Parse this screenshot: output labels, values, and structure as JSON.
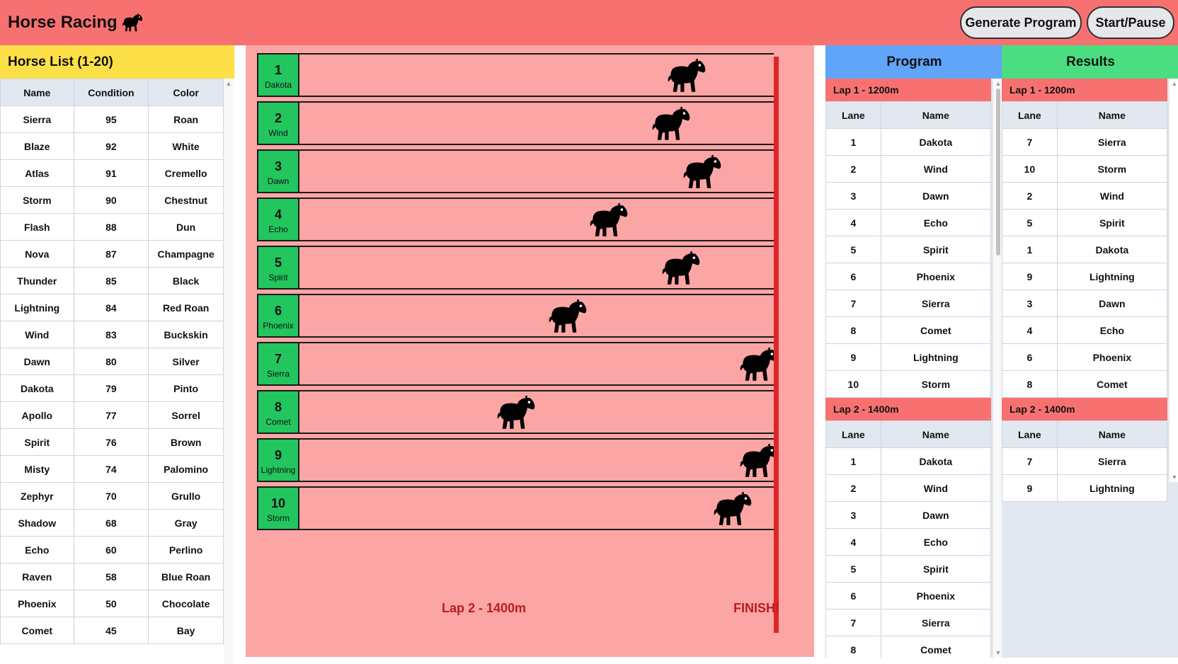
{
  "header": {
    "title": "Horse Racing",
    "generate_label": "Generate Program",
    "start_label": "Start/Pause"
  },
  "horse_list": {
    "title": "Horse List (1-20)",
    "columns": [
      "Name",
      "Condition",
      "Color"
    ],
    "rows": [
      [
        "Sierra",
        "95",
        "Roan"
      ],
      [
        "Blaze",
        "92",
        "White"
      ],
      [
        "Atlas",
        "91",
        "Cremello"
      ],
      [
        "Storm",
        "90",
        "Chestnut"
      ],
      [
        "Flash",
        "88",
        "Dun"
      ],
      [
        "Nova",
        "87",
        "Champagne"
      ],
      [
        "Thunder",
        "85",
        "Black"
      ],
      [
        "Lightning",
        "84",
        "Red Roan"
      ],
      [
        "Wind",
        "83",
        "Buckskin"
      ],
      [
        "Dawn",
        "80",
        "Silver"
      ],
      [
        "Dakota",
        "79",
        "Pinto"
      ],
      [
        "Apollo",
        "77",
        "Sorrel"
      ],
      [
        "Spirit",
        "76",
        "Brown"
      ],
      [
        "Misty",
        "74",
        "Palomino"
      ],
      [
        "Zephyr",
        "70",
        "Grullo"
      ],
      [
        "Shadow",
        "68",
        "Gray"
      ],
      [
        "Echo",
        "60",
        "Perlino"
      ],
      [
        "Raven",
        "58",
        "Blue Roan"
      ],
      [
        "Phoenix",
        "50",
        "Chocolate"
      ],
      [
        "Comet",
        "45",
        "Bay"
      ]
    ]
  },
  "track": {
    "lanes": [
      {
        "num": "1",
        "name": "Dakota",
        "progress": 0.82
      },
      {
        "num": "2",
        "name": "Wind",
        "progress": 0.79
      },
      {
        "num": "3",
        "name": "Dawn",
        "progress": 0.85
      },
      {
        "num": "4",
        "name": "Echo",
        "progress": 0.67
      },
      {
        "num": "5",
        "name": "Spirit",
        "progress": 0.81
      },
      {
        "num": "6",
        "name": "Phoenix",
        "progress": 0.59
      },
      {
        "num": "7",
        "name": "Sierra",
        "progress": 0.96
      },
      {
        "num": "8",
        "name": "Comet",
        "progress": 0.49
      },
      {
        "num": "9",
        "name": "Lightning",
        "progress": 0.96
      },
      {
        "num": "10",
        "name": "Storm",
        "progress": 0.91
      }
    ],
    "lap_label": "Lap 2 - 1400m",
    "finish_label": "FINISH!"
  },
  "program": {
    "title": "Program",
    "columns": [
      "Lane",
      "Name"
    ],
    "laps": [
      {
        "title": "Lap 1 - 1200m",
        "rows": [
          [
            "1",
            "Dakota"
          ],
          [
            "2",
            "Wind"
          ],
          [
            "3",
            "Dawn"
          ],
          [
            "4",
            "Echo"
          ],
          [
            "5",
            "Spirit"
          ],
          [
            "6",
            "Phoenix"
          ],
          [
            "7",
            "Sierra"
          ],
          [
            "8",
            "Comet"
          ],
          [
            "9",
            "Lightning"
          ],
          [
            "10",
            "Storm"
          ]
        ]
      },
      {
        "title": "Lap 2 - 1400m",
        "rows": [
          [
            "1",
            "Dakota"
          ],
          [
            "2",
            "Wind"
          ],
          [
            "3",
            "Dawn"
          ],
          [
            "4",
            "Echo"
          ],
          [
            "5",
            "Spirit"
          ],
          [
            "6",
            "Phoenix"
          ],
          [
            "7",
            "Sierra"
          ],
          [
            "8",
            "Comet"
          ]
        ]
      }
    ]
  },
  "results": {
    "title": "Results",
    "columns": [
      "Lane",
      "Name"
    ],
    "laps": [
      {
        "title": "Lap 1 - 1200m",
        "rows": [
          [
            "7",
            "Sierra"
          ],
          [
            "10",
            "Storm"
          ],
          [
            "2",
            "Wind"
          ],
          [
            "5",
            "Spirit"
          ],
          [
            "1",
            "Dakota"
          ],
          [
            "9",
            "Lightning"
          ],
          [
            "3",
            "Dawn"
          ],
          [
            "4",
            "Echo"
          ],
          [
            "6",
            "Phoenix"
          ],
          [
            "8",
            "Comet"
          ]
        ]
      },
      {
        "title": "Lap 2 - 1400m",
        "rows": [
          [
            "7",
            "Sierra"
          ],
          [
            "9",
            "Lightning"
          ]
        ]
      }
    ]
  },
  "icons": {
    "title_icon": "horse-icon",
    "lane_icon": "horse-icon"
  },
  "colors": {
    "header_bg": "#f87171",
    "horse_list_head": "#fde047",
    "track_bg": "#fca5a5",
    "lane_box": "#22c55e",
    "finish_line": "#dc2626",
    "program_head": "#60a5fa",
    "results_head": "#4ade80",
    "lap_head": "#f87171"
  }
}
